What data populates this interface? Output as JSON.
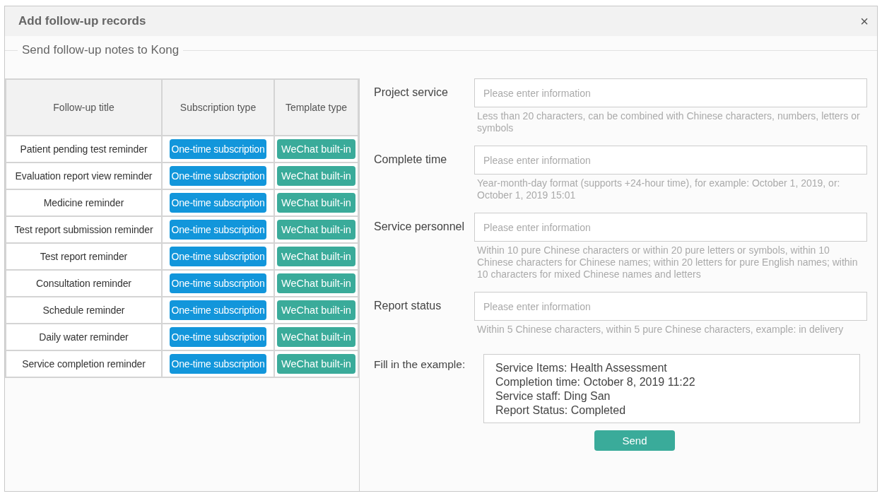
{
  "dialog": {
    "title": "Add follow-up records",
    "close": "×"
  },
  "legend": "Send follow-up notes to Kong",
  "table": {
    "columns": [
      "Follow-up title",
      "Subscription type",
      "Template type"
    ],
    "rows": [
      {
        "title": "Patient pending test reminder",
        "subscription": "One-time subscription",
        "template": "WeChat built-in"
      },
      {
        "title": "Evaluation report view reminder",
        "subscription": "One-time subscription",
        "template": "WeChat built-in"
      },
      {
        "title": "Medicine reminder",
        "subscription": "One-time subscription",
        "template": "WeChat built-in"
      },
      {
        "title": "Test report submission reminder",
        "subscription": "One-time subscription",
        "template": "WeChat built-in"
      },
      {
        "title": "Test report reminder",
        "subscription": "One-time subscription",
        "template": "WeChat built-in"
      },
      {
        "title": "Consultation reminder",
        "subscription": "One-time subscription",
        "template": "WeChat built-in"
      },
      {
        "title": "Schedule reminder",
        "subscription": "One-time subscription",
        "template": "WeChat built-in"
      },
      {
        "title": "Daily water reminder",
        "subscription": "One-time subscription",
        "template": "WeChat built-in"
      },
      {
        "title": "Service completion reminder",
        "subscription": "One-time subscription",
        "template": "WeChat built-in"
      }
    ]
  },
  "form": {
    "fields": [
      {
        "label": "Project service",
        "placeholder": "Please enter information",
        "hint": "Less than 20 characters, can be combined with Chinese characters, numbers, letters or symbols"
      },
      {
        "label": "Complete time",
        "placeholder": "Please enter information",
        "hint": "Year-month-day format (supports +24-hour time), for example: October 1, 2019, or: October 1, 2019 15:01"
      },
      {
        "label": "Service personnel",
        "placeholder": "Please enter information",
        "hint": "Within 10 pure Chinese characters or within 20 pure letters or symbols, within 10 Chinese characters for Chinese names; within 20 letters for pure English names; within 10 characters for mixed Chinese names and letters"
      },
      {
        "label": "Report status",
        "placeholder": "Please enter information",
        "hint": "Within 5 Chinese characters, within 5 pure Chinese characters, example: in delivery"
      }
    ],
    "example": {
      "label": "Fill in the example:",
      "lines": [
        "Service Items: Health Assessment",
        "Completion time: October 8, 2019 11:22",
        "Service staff: Ding San",
        "Report Status: Completed"
      ]
    },
    "send": "Send"
  }
}
